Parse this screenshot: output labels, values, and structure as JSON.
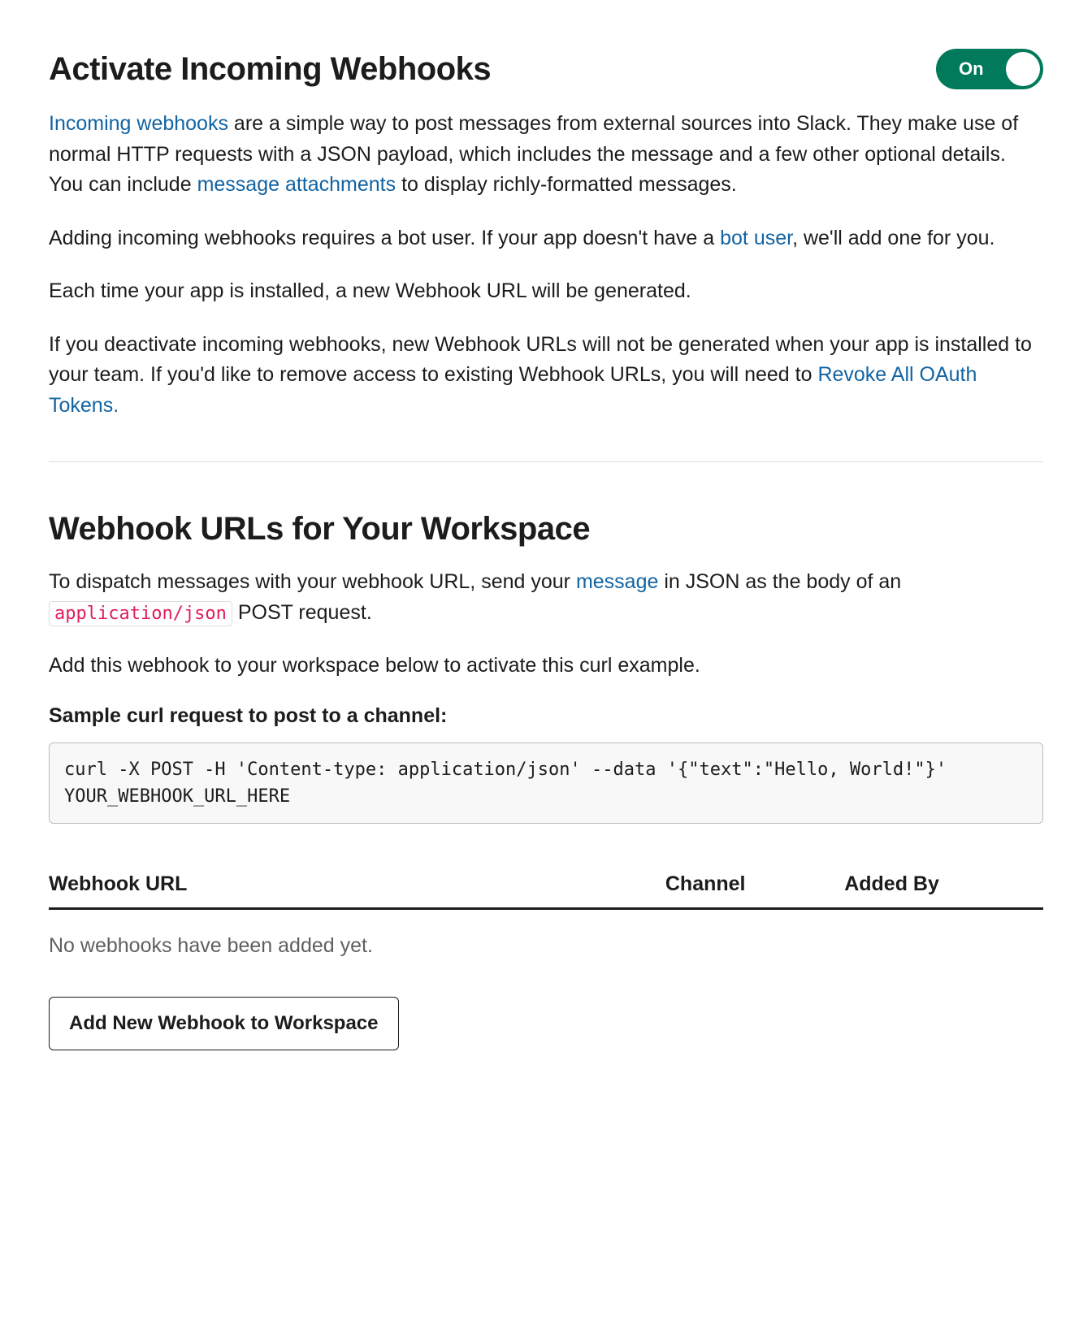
{
  "section1": {
    "title": "Activate Incoming Webhooks",
    "toggle": {
      "state": "On"
    },
    "p1_part1": "Incoming webhooks",
    "p1_part2": " are a simple way to post messages from external sources into Slack. They make use of normal HTTP requests with a JSON payload, which includes the message and a few other optional details. You can include ",
    "p1_link2": "message attachments",
    "p1_part3": " to display richly-formatted messages.",
    "p2_part1": "Adding incoming webhooks requires a bot user. If your app doesn't have a ",
    "p2_link1": "bot user",
    "p2_part2": ", we'll add one for you.",
    "p3": "Each time your app is installed, a new Webhook URL will be generated.",
    "p4_part1": "If you deactivate incoming webhooks, new Webhook URLs will not be generated when your app is installed to your team. If you'd like to remove access to existing Webhook URLs, you will need to ",
    "p4_link1": "Revoke All OAuth Tokens."
  },
  "section2": {
    "title": "Webhook URLs for Your Workspace",
    "p1_part1": "To dispatch messages with your webhook URL, send your ",
    "p1_link1": "message",
    "p1_part2": " in JSON as the body of an ",
    "p1_code": "application/json",
    "p1_part3": " POST request.",
    "p2": "Add this webhook to your workspace below to activate this curl example.",
    "sample_label": "Sample curl request to post to a channel:",
    "code_block": "curl -X POST -H 'Content-type: application/json' --data '{\"text\":\"Hello, World!\"}' YOUR_WEBHOOK_URL_HERE",
    "table": {
      "col_url": "Webhook URL",
      "col_channel": "Channel",
      "col_added": "Added By",
      "empty": "No webhooks have been added yet."
    },
    "add_button": "Add New Webhook to Workspace"
  }
}
